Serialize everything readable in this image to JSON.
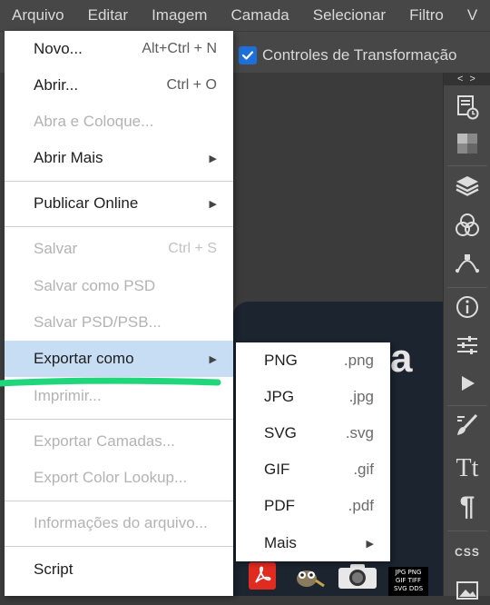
{
  "menubar": [
    "Arquivo",
    "Editar",
    "Imagem",
    "Camada",
    "Selecionar",
    "Filtro",
    "V"
  ],
  "options_bar": {
    "transform_label": "Controles de Transformação",
    "transform_checked": true
  },
  "doc_letter": "a",
  "panel_toggle": "< >",
  "file_menu": [
    {
      "label": "Novo...",
      "shortcut": "Alt+Ctrl + N",
      "disabled": false
    },
    {
      "label": "Abrir...",
      "shortcut": "Ctrl + O",
      "disabled": false
    },
    {
      "label": "Abra e Coloque...",
      "shortcut": "",
      "disabled": true
    },
    {
      "label": "Abrir Mais",
      "shortcut": "",
      "submenu": true,
      "disabled": false
    },
    {
      "label": "Publicar Online",
      "shortcut": "",
      "submenu": true,
      "disabled": false
    },
    {
      "label": "Salvar",
      "shortcut": "Ctrl + S",
      "disabled": true
    },
    {
      "label": "Salvar como PSD",
      "shortcut": "",
      "disabled": true
    },
    {
      "label": "Salvar PSD/PSB...",
      "shortcut": "",
      "disabled": true
    },
    {
      "label": "Exportar como",
      "shortcut": "",
      "submenu": true,
      "active": true,
      "disabled": false
    },
    {
      "label": "Imprimir...",
      "shortcut": "",
      "disabled": true
    },
    {
      "label": "Exportar Camadas...",
      "shortcut": "",
      "disabled": true
    },
    {
      "label": "Export Color Lookup...",
      "shortcut": "",
      "disabled": true
    },
    {
      "label": "Informações do arquivo...",
      "shortcut": "",
      "disabled": true
    },
    {
      "label": "Script",
      "shortcut": "",
      "disabled": false
    }
  ],
  "export_submenu": [
    {
      "label": "PNG",
      "ext": ".png"
    },
    {
      "label": "JPG",
      "ext": ".jpg"
    },
    {
      "label": "SVG",
      "ext": ".svg"
    },
    {
      "label": "GIF",
      "ext": ".gif"
    },
    {
      "label": "PDF",
      "ext": ".pdf"
    },
    {
      "label": "Mais",
      "ext": "",
      "submenu": true
    }
  ],
  "right_panel": {
    "css_label": "CSS",
    "text_tool_glyph": "Tt",
    "paragraph_glyph": "¶"
  },
  "bottom_formats": {
    "line1": "JPG PNG",
    "line2": "GIF TIFF",
    "line3": "SVG DDS"
  },
  "colors": {
    "accent": "#1e6fd9",
    "menu_highlight": "#c6ddf4",
    "annotation": "#1fd67a"
  }
}
